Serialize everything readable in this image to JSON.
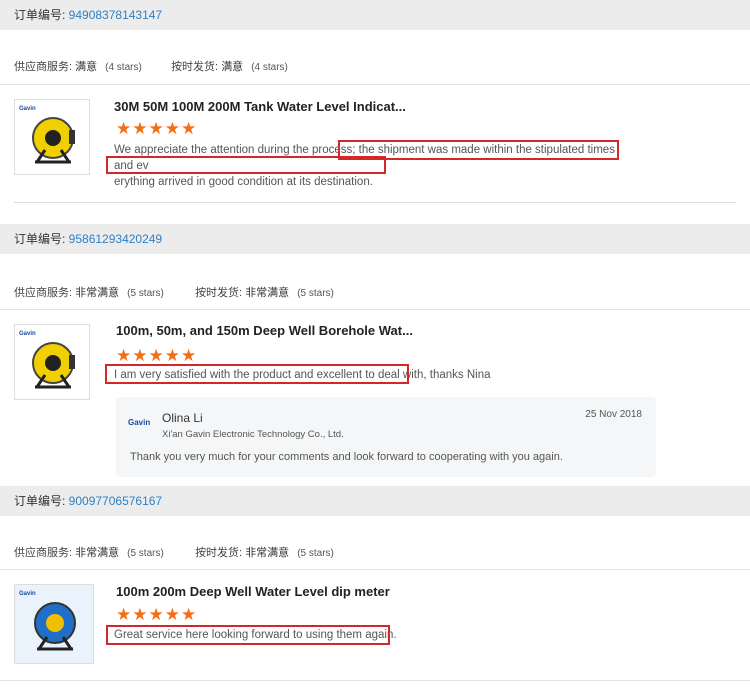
{
  "orders": [
    {
      "order_label": "订单编号: ",
      "order_number": "94908378143147",
      "service_label": "供应商服务: ",
      "service_value": "满意",
      "service_stars": "(4 stars)",
      "ship_label": "按时发货: ",
      "ship_value": "满意",
      "ship_stars": "(4 stars)",
      "product_title": "30M 50M 100M 200M Tank Water Level Indicat...",
      "stars": "★★★★★",
      "rating": 5,
      "review_line1": "We appreciate the attention during the process; the shipment was made within the stipulated times and ev",
      "review_line2": "erything arrived in good condition at its destination."
    },
    {
      "order_label": "订单编号: ",
      "order_number": "95861293420249",
      "service_label": "供应商服务: ",
      "service_value": "非常满意",
      "service_stars": "(5 stars)",
      "ship_label": "按时发货: ",
      "ship_value": "非常满意",
      "ship_stars": "(5 stars)",
      "product_title": "100m, 50m, and 150m Deep Well Borehole Wat...",
      "stars": "★★★★★",
      "rating": 5,
      "review_line1": "I am very satisfied with the product and excellent to deal with, thanks Nina",
      "reply": {
        "name": "Olina Li",
        "company": "Xi'an Gavin Electronic Technology Co., Ltd.",
        "date": "25 Nov 2018",
        "text": "Thank you very much for your comments and look forward to cooperating with you again."
      }
    },
    {
      "order_label": "订单编号: ",
      "order_number": "90097706576167",
      "service_label": "供应商服务: ",
      "service_value": "非常满意",
      "service_stars": "(5 stars)",
      "ship_label": "按时发货: ",
      "ship_value": "非常满意",
      "ship_stars": "(5 stars)",
      "product_title": "100m 200m Deep Well Water Level dip meter",
      "stars": "★★★★★",
      "rating": 5,
      "review_line1": "Great service here looking forward to using them again."
    }
  ],
  "colors": {
    "link": "#2f7fc4",
    "star": "#f36f15",
    "highlight": "#d3282a",
    "bar": "#ececec"
  },
  "icons": [
    "product-reel-image",
    "supplier-logo-icon"
  ],
  "brand_text": "Gavin"
}
